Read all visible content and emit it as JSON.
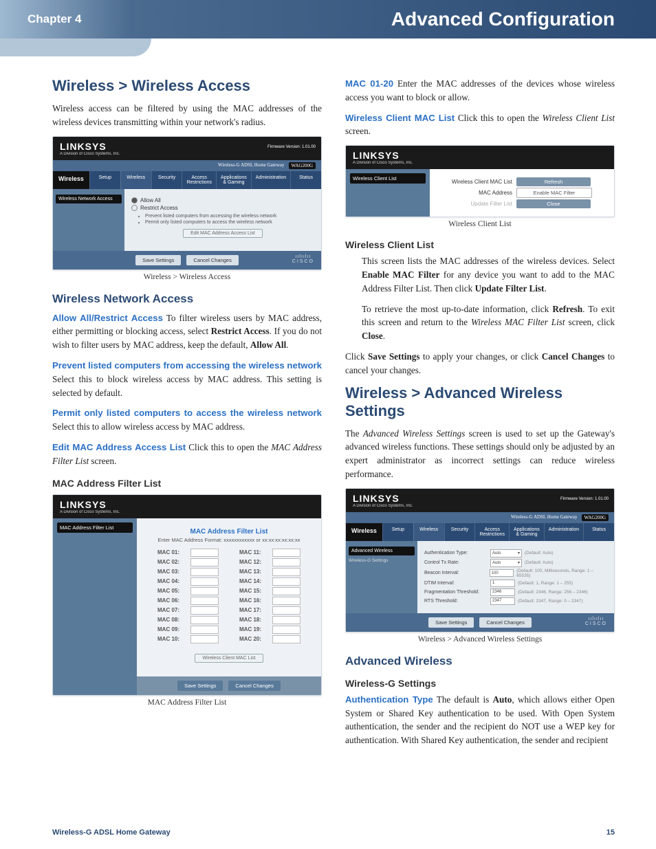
{
  "header": {
    "chapter": "Chapter 4",
    "title": "Advanced Configuration"
  },
  "left": {
    "h1": "Wireless > Wireless Access",
    "intro": "Wireless access can be filtered by using the MAC addresses of the wireless devices transmitting within your network's radius.",
    "fig1": {
      "brand": "LINKSYS",
      "brand_sub": "A Division of Cisco Systems, Inc.",
      "fw": "Firmware Version: 1.01.00",
      "topbar_text": "Wireless-G ADSL Home Gateway",
      "topbar_badge": "WAG200G",
      "side_tab": "Wireless",
      "tabs": [
        "Setup",
        "Wireless",
        "Security",
        "Access Restrictions",
        "Applications & Gaming",
        "Administration",
        "Status"
      ],
      "side_item": "Wireless Network Access",
      "radio1": "Allow All",
      "radio2": "Restrict Access",
      "li1": "Prevent listed computers from accessing the wireless network",
      "li2": "Permit only listed computers to access the wireless network",
      "edit_btn": "Edit MAC Address Access List",
      "save": "Save Settings",
      "cancel": "Cancel Changes",
      "cisco": "CISCO",
      "caption": "Wireless > Wireless Access"
    },
    "h2a": "Wireless Network Access",
    "p1_lead": "Allow All/Restrict Access",
    "p1_body": "  To filter wireless users by MAC address, either permitting or blocking access, select ",
    "p1_b1": "Restrict Access",
    "p1_body2": ". If you do not wish to filter users by MAC address, keep the default, ",
    "p1_b2": "Allow All",
    "p1_end": ".",
    "p2_lead": "Prevent listed computers from accessing the wireless network",
    "p2_body": "  Select this to block wireless access by MAC address. This setting is selected by default.",
    "p3_lead": "Permit only listed computers to access the wireless network",
    "p3_body": "  Select this to allow wireless access by MAC address.",
    "p4_lead": "Edit MAC Address Access List",
    "p4_body": "  Click this to open the ",
    "p4_i": "MAC Address Filter List",
    "p4_end": " screen.",
    "h3a": "MAC Address Filter List",
    "fig2": {
      "brand": "LINKSYS",
      "brand_sub": "A Division of Cisco Systems, Inc.",
      "side_item": "MAC Address Filter List",
      "panel_title": "MAC Address Filter List",
      "fmt": "Enter MAC Address Format: xxxxxxxxxxxx or xx:xx:xx:xx:xx:xx",
      "labels_left": [
        "MAC 01:",
        "MAC 02:",
        "MAC 03:",
        "MAC 04:",
        "MAC 05:",
        "MAC 06:",
        "MAC 07:",
        "MAC 08:",
        "MAC 09:",
        "MAC 10:"
      ],
      "labels_right": [
        "MAC 11:",
        "MAC 12:",
        "MAC 13:",
        "MAC 14:",
        "MAC 15:",
        "MAC 16:",
        "MAC 17:",
        "MAC 18:",
        "MAC 19:",
        "MAC 20:"
      ],
      "wcl_btn": "Wireless Client MAC List",
      "save": "Save Settings",
      "cancel": "Cancel Changes",
      "caption": "MAC Address Filter List"
    }
  },
  "right": {
    "p1_lead": "MAC 01-20",
    "p1_body": "  Enter the MAC addresses of the devices whose wireless access you want to block or allow.",
    "p2_lead": "Wireless Client MAC List",
    "p2_body": "  Click this to open the ",
    "p2_i": "Wireless Client List",
    "p2_end": " screen.",
    "fig3": {
      "brand": "LINKSYS",
      "brand_sub": "A Division of Cisco Systems, Inc.",
      "side_item": "Wireless Client List",
      "row1_label": "Wireless Client MAC List",
      "row1_btn": "Refresh",
      "row2_label": "MAC Address",
      "row2_btn": "Enable MAC Filter",
      "row3_label": "Update Filter List",
      "row3_btn": "Close",
      "caption": "Wireless Client List"
    },
    "h3a": "Wireless Client List",
    "p3a": "This screen lists the MAC addresses of the wireless devices. Select ",
    "p3a_b": "Enable MAC Filter",
    "p3b": " for any device you want to add to the MAC Address Filter List. Then click ",
    "p3b_b": "Update Filter List",
    "p3b_end": ".",
    "p4a": "To retrieve the most up-to-date information, click ",
    "p4a_b": "Refresh",
    "p4b": ". To exit this screen and return to the ",
    "p4b_i": "Wireless MAC Filter List",
    "p4c": " screen, click ",
    "p4c_b": "Close",
    "p4c_end": ".",
    "p5a": "Click ",
    "p5a_b": "Save Settings",
    "p5b": " to apply your changes, or click ",
    "p5b_b": "Cancel Changes",
    "p5c": " to cancel your changes.",
    "h1": "Wireless > Advanced Wireless Settings",
    "intro": "The ",
    "intro_i": "Advanced Wireless Settings",
    "intro2": " screen is used to set up the Gateway's advanced wireless functions. These settings should only be adjusted by an expert administrator as incorrect settings can reduce wireless performance.",
    "fig4": {
      "brand": "LINKSYS",
      "brand_sub": "A Division of Cisco Systems, Inc.",
      "fw": "Firmware Version: 1.01.00",
      "topbar_text": "Wireless-G ADSL Home Gateway",
      "topbar_badge": "WAG200G",
      "side_tab": "Wireless",
      "tabs": [
        "Setup",
        "Wireless",
        "Security",
        "Access Restrictions",
        "Applications & Gaming",
        "Administration",
        "Status"
      ],
      "side_item": "Advanced Wireless",
      "side_item2": "Wireless-G Settings",
      "rows": [
        {
          "l": "Authentication Type:",
          "v": "Auto",
          "n": "(Default: Auto)"
        },
        {
          "l": "Control Tx Rate:",
          "v": "Auto",
          "n": "(Default: Auto)"
        },
        {
          "l": "Beacon Interval:",
          "v": "100",
          "n": "(Default: 100, Milliseconds, Range: 1 – 65535)"
        },
        {
          "l": "DTIM Interval:",
          "v": "1",
          "n": "(Default: 1, Range: 1 – 255)"
        },
        {
          "l": "Fragmentation Threshold:",
          "v": "2346",
          "n": "(Default: 2346, Range: 256 – 2346)"
        },
        {
          "l": "RTS Threshold:",
          "v": "2347",
          "n": "(Default: 2347, Range: 0 – 2347)"
        }
      ],
      "save": "Save Settings",
      "cancel": "Cancel Changes",
      "cisco": "CISCO",
      "caption": "Wireless > Advanced Wireless Settings"
    },
    "h2a": "Advanced Wireless",
    "h3b": "Wireless-G Settings",
    "p6_lead": "Authentication Type",
    "p6a": "  The default is ",
    "p6a_b": "Auto",
    "p6b": ", which allows either Open System or Shared Key authentication to be used. With Open System authentication, the sender and the recipient do NOT use a WEP key for authentication. With Shared Key authentication, the sender and recipient"
  },
  "footer": {
    "product": "Wireless-G ADSL Home Gateway",
    "page": "15"
  }
}
